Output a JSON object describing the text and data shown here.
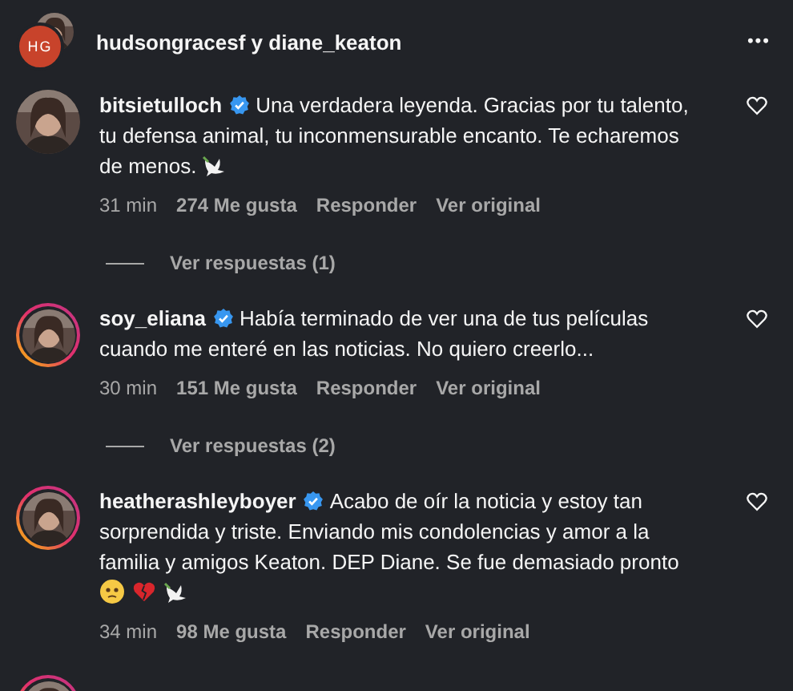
{
  "header": {
    "initials": "HG",
    "title": "hudsongracesf y diane_keaton",
    "more": "•••"
  },
  "comments": [
    {
      "username": "bitsietulloch",
      "verified": true,
      "story_ring": false,
      "text": "Una verdadera leyenda. Gracias por tu talento, tu defensa animal, tu inconmensurable encanto. Te echaremos de menos.",
      "emojis": [
        {
          "kind": "dove"
        }
      ],
      "time": "31 min",
      "likes": "274 Me gusta",
      "reply": "Responder",
      "translate": "Ver original",
      "replies": "Ver respuestas (1)"
    },
    {
      "username": "soy_eliana",
      "verified": true,
      "story_ring": true,
      "text": "Había terminado de ver una de tus películas cuando me enteré en las noticias. No quiero creerlo...",
      "time": "30 min",
      "likes": "151 Me gusta",
      "reply": "Responder",
      "translate": "Ver original",
      "replies": "Ver respuestas (2)"
    },
    {
      "username": "heatherashleyboyer",
      "verified": true,
      "story_ring": true,
      "text": "Acabo de oír la noticia y estoy tan sorprendida y triste. Enviando mis condolencias y amor a la familia y amigos Keaton. DEP Diane. Se fue demasiado pronto",
      "emojis": [
        {
          "kind": "sad"
        },
        {
          "kind": "broken-heart"
        },
        {
          "kind": "dove"
        }
      ],
      "time": "34 min",
      "likes": "98 Me gusta",
      "reply": "Responder",
      "translate": "Ver original"
    }
  ],
  "next_comment": {
    "story_ring": true
  }
}
